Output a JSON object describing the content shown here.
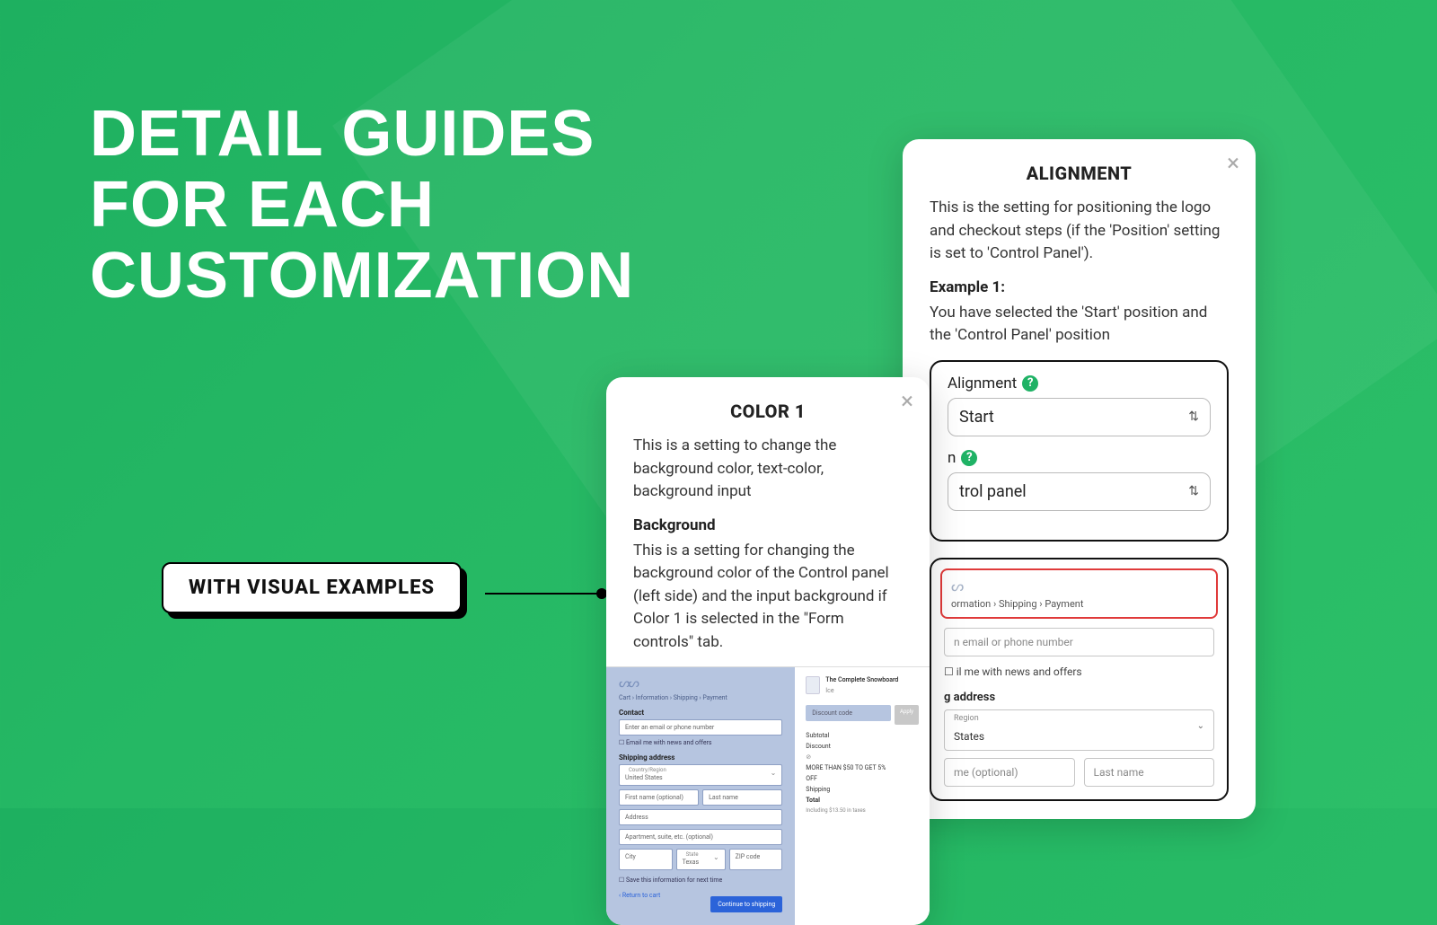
{
  "headline": {
    "line1": "DETAIL GUIDES",
    "line2": "FOR EACH",
    "line3": "CUSTOMIZATION"
  },
  "badge": {
    "text": "WITH VISUAL EXAMPLES"
  },
  "alignCard": {
    "title": "ALIGNMENT",
    "desc": "This is the setting for positioning the logo and checkout steps (if the 'Position' setting is set to 'Control Panel').",
    "example_label": "Example 1:",
    "example_desc": "You have selected the 'Start' position and the 'Control Panel' position",
    "field1_label": "Alignment",
    "field1_value": "Start",
    "field2_label_suffix": "n",
    "field2_value_tail": "trol panel",
    "preview": {
      "logo": "ᔕ",
      "crumbs": "ormation  ›  Shipping  ›  Payment",
      "email_ph": "n email or phone number",
      "news": "il me with news and offers",
      "ship_label": "g address",
      "region_tiny": "Region",
      "region_val": "States",
      "first_ph": "me (optional)",
      "last_ph": "Last name"
    }
  },
  "colorCard": {
    "title": "COLOR 1",
    "desc": "This is a setting to change the background color, text-color, background input",
    "bg_label": "Background",
    "bg_desc": "This is a setting for changing the background color of the Control panel (left side) and the input background if Color 1 is selected in the \"Form controls\" tab.",
    "mock": {
      "logo": "ᔕᔕ",
      "crumbs": "Cart  ›  Information  ›  Shipping  ›  Payment",
      "contact": "Contact",
      "email_ph": "Enter an email or phone number",
      "news": "Email me with news and offers",
      "ship": "Shipping address",
      "country_tiny": "Country/Region",
      "country_val": "United States",
      "first_ph": "First name (optional)",
      "last_ph": "Last name",
      "addr_ph": "Address",
      "apt_ph": "Apartment, suite, etc. (optional)",
      "city_ph": "City",
      "state_tiny": "State",
      "state_val": "Texas",
      "zip_ph": "ZIP code",
      "save": "Save this information for next time",
      "return": "‹  Return to cart",
      "continue": "Continue to shipping",
      "prod_title": "The Complete Snowboard",
      "prod_sub": "Ice",
      "disc_ph": "Discount code",
      "apply": "Apply",
      "subtotal": "Subtotal",
      "discount": "Discount",
      "promo1": "MORE THAN $50 TO GET 5%",
      "promo2": "OFF",
      "shipping": "Shipping",
      "total": "Total",
      "total_sub": "Including $13.50 in taxes"
    }
  }
}
